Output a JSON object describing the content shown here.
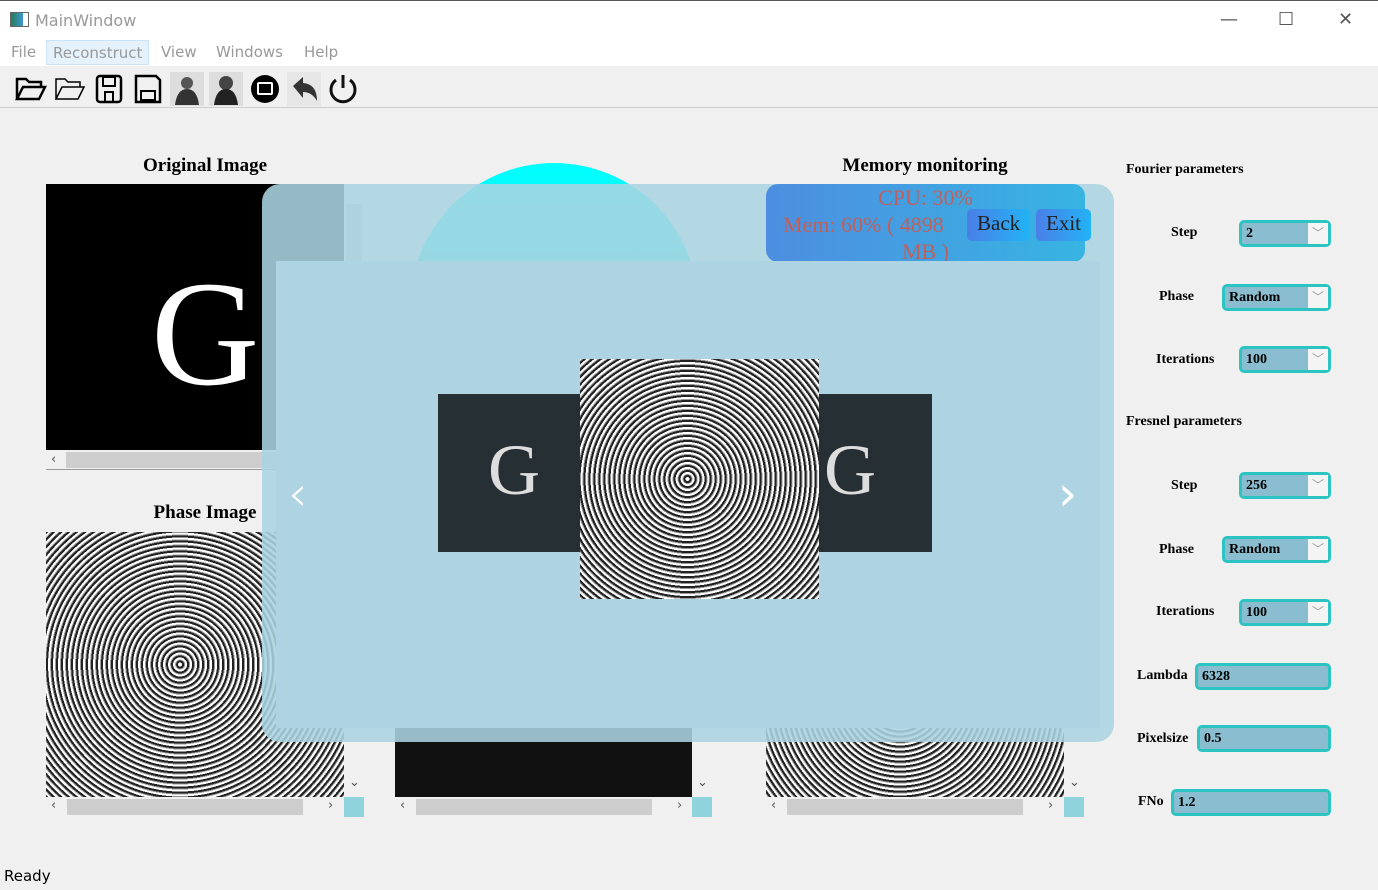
{
  "window": {
    "title": "MainWindow",
    "minimize": "—",
    "maximize": "☐",
    "close": "✕"
  },
  "menu": [
    "File",
    "Reconstruct",
    "View",
    "Windows",
    "Help"
  ],
  "menu_active": "Reconstruct",
  "toolbar": [
    "open-folder",
    "open-folder-outline",
    "save",
    "save-as",
    "portrait-fourier",
    "portrait-fresnel",
    "image-display",
    "undo",
    "power"
  ],
  "panels": {
    "original_title": "Original Image",
    "phase_title": "Phase Image",
    "memory_title": "Memory monitoring",
    "image_letter": "G"
  },
  "memory": {
    "cpu": "CPU: 30%",
    "mem": "Mem: 60% ( 4898",
    "mem_unit": "MB )",
    "back": "Back",
    "exit": "Exit"
  },
  "carousel": {
    "prev": "‹",
    "next": "›"
  },
  "fourier": {
    "title": "Fourier parameters",
    "step_label": "Step",
    "step": "2",
    "phase_label": "Phase",
    "phase": "Random",
    "iter_label": "Iterations",
    "iter": "100"
  },
  "fresnel": {
    "title": "Fresnel parameters",
    "step_label": "Step",
    "step": "256",
    "phase_label": "Phase",
    "phase": "Random",
    "iter_label": "Iterations",
    "iter": "100",
    "lambda_label": "Lambda",
    "lambda": "6328",
    "pixel_label": "Pixelsize",
    "pixel": "0.5",
    "fno_label": "FNo",
    "fno": "1.2"
  },
  "status": "Ready",
  "colors": {
    "accent": "#2cc3c3",
    "field": "#8bbdd0",
    "overlay": "#aed3e3"
  }
}
